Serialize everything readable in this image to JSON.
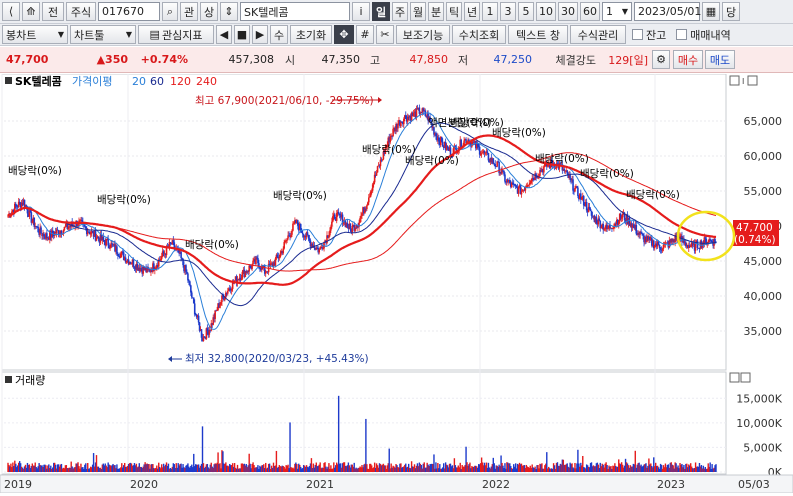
{
  "toolbar_top": {
    "market": "주식",
    "code": "017670",
    "lookup": "관",
    "stock_name": "SK텔레콤",
    "info": "i",
    "period_tabs": [
      "일",
      "주",
      "월",
      "분",
      "틱",
      "년"
    ],
    "selected_period": "일",
    "intervals": [
      "1",
      "3",
      "5",
      "10",
      "30",
      "60"
    ],
    "interval_value": "1",
    "date": "2023/05/01",
    "fetch": "당"
  },
  "toolbar_second": {
    "candle": "봉차트",
    "chart_tools": "차트툴",
    "interest": "관심지표",
    "number": "수",
    "reset": "초기화",
    "aux": "보조기능",
    "query": "수치조회",
    "textwin": "텍스트 창",
    "formula": "수식관리",
    "balance": "잔고",
    "history": "매매내역"
  },
  "quote": {
    "price": "47,700",
    "change": "▲350",
    "change_pct": "+0.74%",
    "volume": "457,308",
    "open_label": "시",
    "open": "47,350",
    "high_label": "고",
    "high": "47,850",
    "low_label": "저",
    "low": "47,250",
    "strength_label": "체결강도",
    "strength": "129[일]",
    "buy": "매수",
    "sell": "매도"
  },
  "chart_data": {
    "type": "candlestick",
    "title": "SK텔레콤",
    "indicators": [
      {
        "label": "가격이평",
        "color": "#2a7fd8"
      },
      {
        "label": "20",
        "color": "#2a7fd8"
      },
      {
        "label": "60",
        "color": "#1a2a90"
      },
      {
        "label": "120",
        "color": "#e51c1c"
      },
      {
        "label": "240",
        "color": "#e51c1c"
      }
    ],
    "ylim": [
      30000,
      70000
    ],
    "y_ticks": [
      35000,
      40000,
      45000,
      50000,
      55000,
      60000,
      65000
    ],
    "y_tick_labels": [
      "35,000",
      "40,000",
      "45,000",
      "50,000",
      "55,000",
      "60,000",
      "65,000"
    ],
    "x_labels": [
      "2019",
      "2020",
      "2021",
      "2022",
      "2023",
      "05/03"
    ],
    "annotations": {
      "high": "최고 67,900(2021/06/10, -29.75%)",
      "low": "최저 32,800(2020/03/23, +45.43%)",
      "dividends": [
        "배당락(0%)",
        "배당락(0%)",
        "배당락(0%)",
        "배당락(0%)",
        "배당락(0%)",
        "배당락(0%)",
        "배당락(0%)",
        "액면분할(0%)",
        "배당락(0%)",
        "배당락(0%)",
        "배당락(0%)",
        "배당락(0%)"
      ],
      "current_price": "47,700",
      "current_pct": "(0.74%)"
    },
    "close_series": [
      51500,
      52800,
      53500,
      51000,
      49200,
      48500,
      49000,
      49500,
      50000,
      50500,
      49600,
      48800,
      48000,
      47500,
      46500,
      45500,
      44800,
      44000,
      43500,
      44500,
      46000,
      47500,
      46000,
      43000,
      38000,
      34000,
      35500,
      38500,
      40500,
      42000,
      43000,
      44000,
      45000,
      43500,
      44500,
      46000,
      48500,
      50500,
      49000,
      47500,
      46500,
      48500,
      51500,
      51000,
      49500,
      50500,
      53000,
      56500,
      59500,
      62500,
      64500,
      65500,
      65800,
      66500,
      65500,
      63000,
      61500,
      60500,
      61500,
      62500,
      61500,
      60500,
      59500,
      58500,
      56500,
      55500,
      55000,
      56500,
      57500,
      58500,
      59000,
      58500,
      57000,
      55000,
      53500,
      51500,
      50500,
      49500,
      50500,
      51500,
      50500,
      49000,
      48000,
      47500,
      47000,
      47500,
      48500,
      47500,
      47000,
      47500,
      48000,
      47700
    ],
    "volume_ylim": [
      0,
      17500
    ],
    "volume_ticks": [
      0,
      5000,
      10000,
      15000
    ],
    "volume_tick_labels": [
      "0K",
      "5,000K",
      "10,000K",
      "15,000K"
    ],
    "volume_title": "거래량"
  }
}
